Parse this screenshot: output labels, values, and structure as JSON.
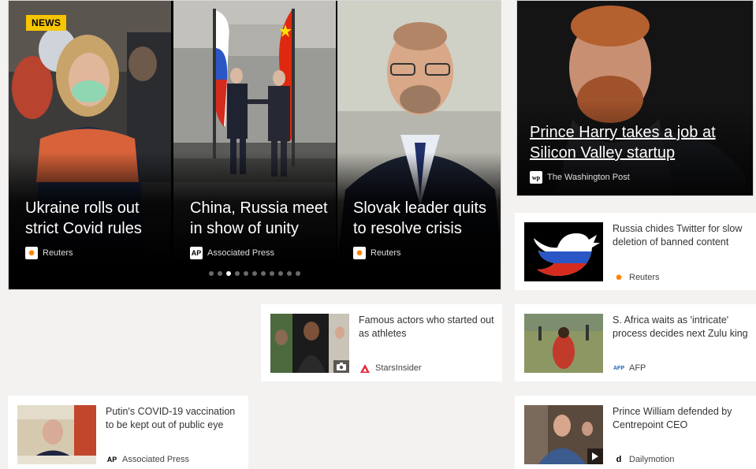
{
  "carousel": {
    "badge": "NEWS",
    "slides": [
      {
        "title": "Ukraine rolls out strict Covid rules",
        "source": "Reuters",
        "source_icon": "reuters-logo"
      },
      {
        "title": "China, Russia meet in show of unity",
        "source": "Associated Press",
        "source_icon": "ap-logo"
      },
      {
        "title": "Slovak leader quits to resolve crisis",
        "source": "Reuters",
        "source_icon": "reuters-logo"
      }
    ],
    "page_count": 11,
    "active_page": 3
  },
  "feature": {
    "title": "Prince Harry takes a job at Silicon Valley startup",
    "source": "The Washington Post",
    "source_icon": "washington-post-logo"
  },
  "cards": [
    {
      "title": "Russia chides Twitter for slow deletion of banned content",
      "source": "Reuters",
      "source_icon": "reuters-logo"
    },
    {
      "title": "Famous actors who started out as athletes",
      "source": "StarsInsider",
      "source_icon": "starsinsider-logo",
      "thumb_badge": "camera-icon"
    },
    {
      "title": "S. Africa waits as 'intricate' process decides next Zulu king",
      "source": "AFP",
      "source_icon": "afp-logo"
    },
    {
      "title": "Putin's COVID-19 vaccination to be kept out of public eye",
      "source": "Associated Press",
      "source_icon": "ap-logo"
    },
    {
      "title": "Prince William defended by Centrepoint CEO",
      "source": "Dailymotion",
      "source_icon": "dailymotion-logo",
      "thumb_badge": "play-icon"
    }
  ],
  "colors": {
    "badge": "#f7c600",
    "reuters": "#ff8000",
    "starsinsider": "#e8263c",
    "afp": "#1a5fb4"
  }
}
